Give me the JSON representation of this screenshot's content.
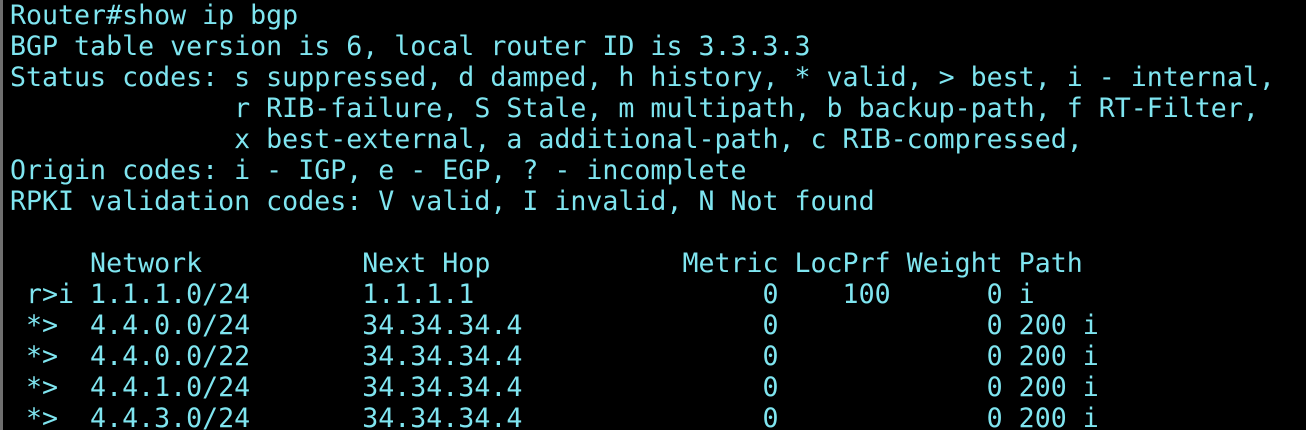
{
  "terminal": {
    "lines": [
      "Router#show ip bgp",
      "BGP table version is 6, local router ID is 3.3.3.3",
      "Status codes: s suppressed, d damped, h history, * valid, > best, i - internal,",
      "              r RIB-failure, S Stale, m multipath, b backup-path, f RT-Filter,",
      "              x best-external, a additional-path, c RIB-compressed,",
      "Origin codes: i - IGP, e - EGP, ? - incomplete",
      "RPKI validation codes: V valid, I invalid, N Not found",
      "",
      "     Network          Next Hop            Metric LocPrf Weight Path",
      " r>i 1.1.1.0/24       1.1.1.1                  0    100      0 i",
      " *>  4.4.0.0/24       34.34.34.4               0             0 200 i",
      " *>  4.4.0.0/22       34.34.34.4               0             0 200 i",
      " *>  4.4.1.0/24       34.34.34.4               0             0 200 i",
      " *>  4.4.3.0/24       34.34.34.4               0             0 200 i"
    ],
    "text_color": "#7fe5f0",
    "background_color": "#000000"
  }
}
